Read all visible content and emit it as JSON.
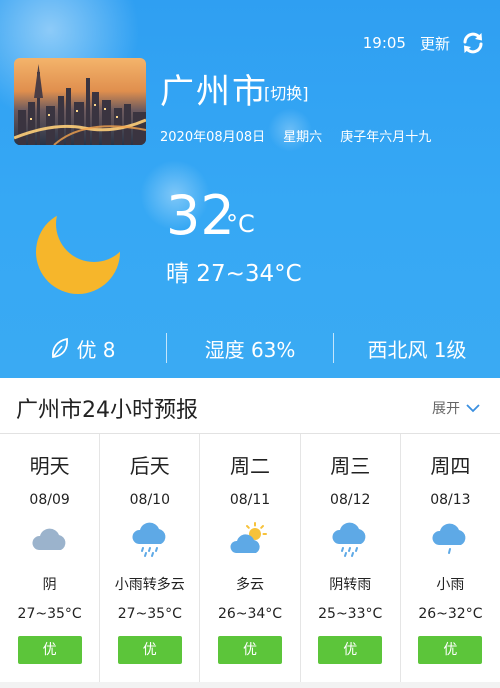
{
  "header": {
    "time": "19:05",
    "refresh_label": "更新",
    "city": "广州市",
    "switch_label": "[切换]",
    "date": "2020年08月08日",
    "weekday": "星期六",
    "lunar": "庚子年六月十九"
  },
  "current": {
    "temp": "32",
    "unit": "°C",
    "summary": "晴 27~34°C",
    "icon": "crescent-moon-icon"
  },
  "stats": {
    "aqi": "优 8",
    "humidity": "湿度 63%",
    "wind": "西北风 1级"
  },
  "forecast": {
    "title": "广州市24小时预报",
    "expand_label": "展开",
    "days": [
      {
        "name": "明天",
        "date": "08/09",
        "icon": "overcast-icon",
        "desc": "阴",
        "range": "27~35°C",
        "aqi": "优"
      },
      {
        "name": "后天",
        "date": "08/10",
        "icon": "rain-icon",
        "desc": "小雨转多云",
        "range": "27~35°C",
        "aqi": "优"
      },
      {
        "name": "周二",
        "date": "08/11",
        "icon": "partly-cloudy-icon",
        "desc": "多云",
        "range": "26~34°C",
        "aqi": "优"
      },
      {
        "name": "周三",
        "date": "08/12",
        "icon": "rain-icon",
        "desc": "阴转雨",
        "range": "25~33°C",
        "aqi": "优"
      },
      {
        "name": "周四",
        "date": "08/13",
        "icon": "light-rain-icon",
        "desc": "小雨",
        "range": "26~32°C",
        "aqi": "优"
      }
    ]
  },
  "colors": {
    "sky_blue": "#36a8f4",
    "moon_yellow": "#f6b62b",
    "aqi_green": "#5cc53a",
    "cloud_grey": "#9bb3cc",
    "rain_cloud": "#5ea9e6",
    "sun_yellow": "#f7c23a"
  }
}
